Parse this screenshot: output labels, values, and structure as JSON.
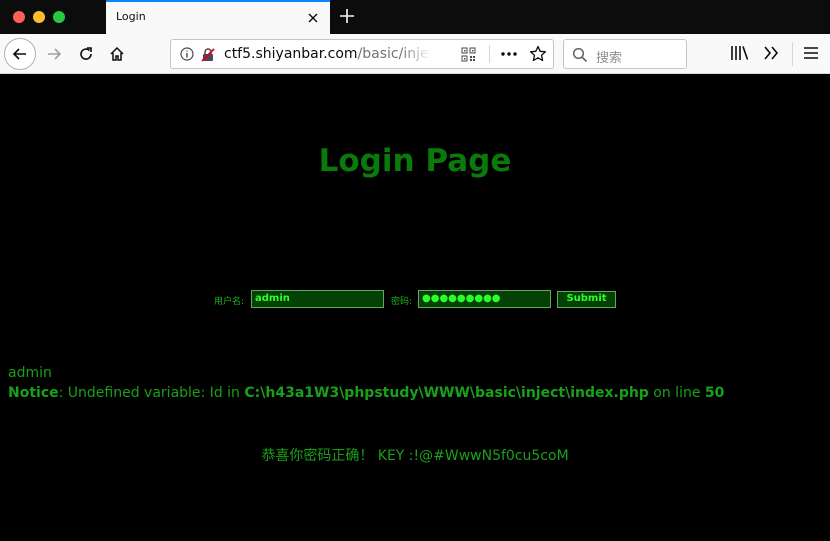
{
  "browser": {
    "tab_title": "Login",
    "url_host": "ctf5.shiyanbar.com",
    "url_rest": "/basic/inject",
    "search_placeholder": "搜索"
  },
  "page": {
    "heading": "Login Page",
    "form": {
      "username_label": "用户名:",
      "username_value": "admin",
      "password_label": "密码:",
      "password_value": "●●●●●●●●●",
      "submit_label": "Submit"
    },
    "output": {
      "echoed_user": "admin",
      "notice_label": "Notice",
      "notice_text": ": Undefined variable: Id in ",
      "notice_path": "C:\\h43a1W3\\phpstudy\\WWW\\basic\\inject\\index.php",
      "notice_line_text": " on line ",
      "notice_line": "50",
      "success_text": "恭喜你密码正确！ KEY :!@#WwwN5f0cu5coM"
    }
  },
  "colors": {
    "heading_green": "#0a7a0a",
    "text_green": "#19a019",
    "field_bg": "#054005",
    "field_text": "#29ff29",
    "tab_accent": "#0a84ff"
  }
}
